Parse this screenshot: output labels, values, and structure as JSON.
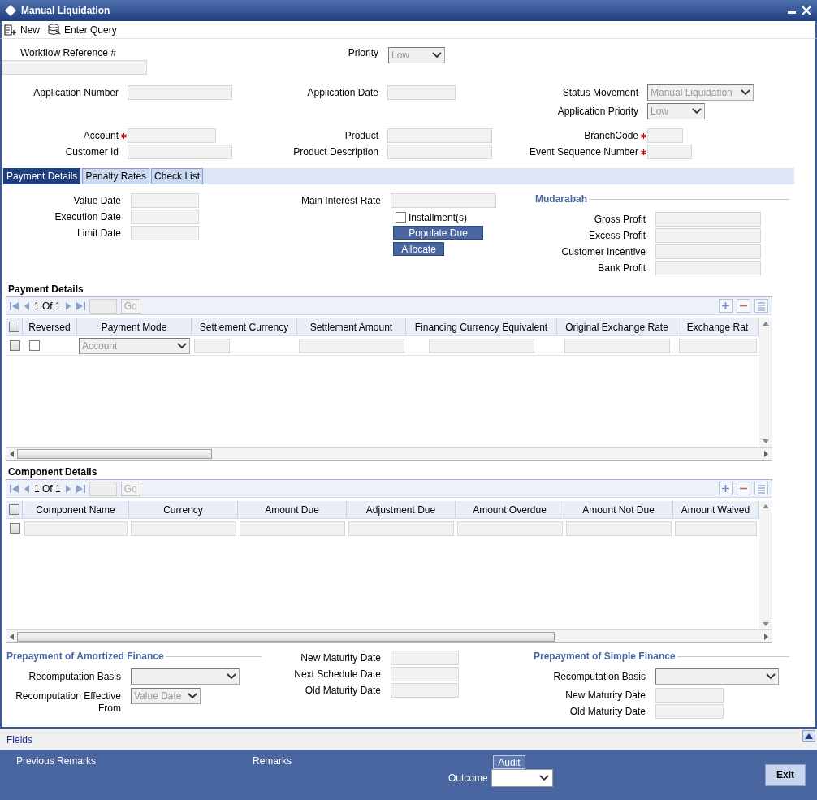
{
  "window": {
    "title": "Manual Liquidation"
  },
  "toolbar": [
    {
      "label": "New"
    },
    {
      "label": "Enter Query"
    }
  ],
  "header": {
    "workflow_reference": {
      "label": "Workflow Reference #",
      "required": false
    },
    "priority": {
      "label": "Priority",
      "value": "Low",
      "required": false
    },
    "application_number": {
      "label": "Application Number",
      "required": false
    },
    "application_date": {
      "label": "Application Date",
      "required": false
    },
    "status_movement": {
      "label": "Status Movement",
      "value": "Manual Liquidation",
      "required": false
    },
    "application_priority": {
      "label": "Application Priority",
      "value": "Low",
      "required": false
    },
    "account": {
      "label": "Account",
      "required": true
    },
    "product": {
      "label": "Product",
      "required": false
    },
    "branch_code": {
      "label": "BranchCode",
      "required": true
    },
    "customer_id": {
      "label": "Customer Id",
      "required": false
    },
    "product_description": {
      "label": "Product Description",
      "required": false
    },
    "event_sequence_number": {
      "label": "Event Sequence Number",
      "required": true
    }
  },
  "tabs": [
    {
      "label": "Payment Details",
      "selected": true
    },
    {
      "label": "Penalty Rates",
      "selected": false
    },
    {
      "label": "Check List",
      "selected": false
    }
  ],
  "payment_tab": {
    "dates": [
      {
        "label": "Value Date"
      },
      {
        "label": "Execution Date"
      },
      {
        "label": "Limit Date"
      }
    ],
    "main_interest_rate": {
      "label": "Main Interest Rate"
    },
    "installments": {
      "label": "Installment(s)",
      "checked": false
    },
    "buttons": [
      "Populate Due",
      "Allocate"
    ],
    "mudarabah": {
      "title": "Mudarabah",
      "fields": [
        {
          "label": "Gross Profit"
        },
        {
          "label": "Excess Profit"
        },
        {
          "label": "Customer Incentive"
        },
        {
          "label": "Bank Profit"
        }
      ]
    }
  },
  "payment_details": {
    "title": "Payment Details",
    "pager": "1 Of 1",
    "go": "Go",
    "all_selected": false,
    "columns": [
      "Reversed",
      "Payment Mode",
      "Settlement Currency",
      "Settlement Amount",
      "Financing Currency Equivalent",
      "Original Exchange Rate",
      "Exchange Rat"
    ],
    "rows": [
      {
        "selected": false,
        "reversed": false,
        "payment_mode": "Account"
      }
    ]
  },
  "component_details": {
    "title": "Component Details",
    "pager": "1 Of 1",
    "go": "Go",
    "all_selected": false,
    "columns": [
      "Component Name",
      "Currency",
      "Amount Due",
      "Adjustment Due",
      "Amount Overdue",
      "Amount Not Due",
      "Amount Waived"
    ],
    "rows": [
      {
        "selected": false
      }
    ]
  },
  "prepayment_amortized": {
    "title": "Prepayment of Amortized Finance",
    "fields": [
      {
        "label": "Recomputation Basis",
        "kind": "select"
      },
      {
        "label": "Recomputation Effective From",
        "kind": "select",
        "value": "Value Date"
      }
    ]
  },
  "maturity": [
    {
      "label": "New Maturity Date"
    },
    {
      "label": "Next Schedule Date"
    },
    {
      "label": "Old Maturity Date"
    }
  ],
  "prepayment_simple": {
    "title": "Prepayment of Simple Finance",
    "fields": [
      {
        "label": "Recomputation Basis",
        "kind": "select"
      },
      {
        "label": "New Maturity Date",
        "kind": "text"
      },
      {
        "label": "Old Maturity Date",
        "kind": "text"
      }
    ]
  },
  "fields_bar": {
    "label": "Fields"
  },
  "footer": {
    "previous_remarks": "Previous Remarks",
    "remarks": "Remarks",
    "audit": "Audit",
    "outcome": "Outcome",
    "exit": "Exit"
  }
}
